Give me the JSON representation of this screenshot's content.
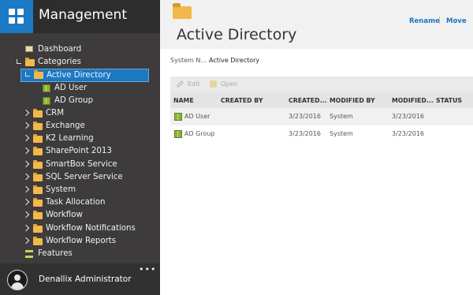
{
  "app": {
    "title": "Management",
    "brand_color": "#1a7ac3"
  },
  "sidebar": {
    "items": [
      {
        "label": "Dashboard",
        "icon": "dashboard-icon"
      },
      {
        "label": "Categories",
        "icon": "folder-icon"
      },
      {
        "label": "Active Directory",
        "icon": "folder-icon",
        "selected": true
      },
      {
        "label": "AD User",
        "icon": "smartobject-icon"
      },
      {
        "label": "AD Group",
        "icon": "smartobject-icon"
      },
      {
        "label": "CRM",
        "icon": "folder-icon"
      },
      {
        "label": "Exchange",
        "icon": "folder-icon"
      },
      {
        "label": "K2 Learning",
        "icon": "folder-icon"
      },
      {
        "label": "SharePoint 2013",
        "icon": "folder-icon"
      },
      {
        "label": "SmartBox Service",
        "icon": "folder-icon"
      },
      {
        "label": "SQL Server Service",
        "icon": "folder-icon"
      },
      {
        "label": "System",
        "icon": "folder-icon"
      },
      {
        "label": "Task Allocation",
        "icon": "folder-icon"
      },
      {
        "label": "Workflow",
        "icon": "folder-icon"
      },
      {
        "label": "Workflow Notifications",
        "icon": "folder-icon"
      },
      {
        "label": "Workflow Reports",
        "icon": "folder-icon"
      },
      {
        "label": "Features",
        "icon": "features-icon"
      }
    ]
  },
  "user": {
    "name": "Denallix Administrator",
    "more": "•••"
  },
  "header": {
    "title": "Active Directory",
    "actions": {
      "rename": "Rename",
      "separator": "|",
      "move": "Move"
    }
  },
  "info": {
    "label": "System N...",
    "value": "Active Directory"
  },
  "toolbar": {
    "edit": "Edit",
    "open": "Open"
  },
  "table": {
    "columns": [
      "NAME",
      "CREATED BY",
      "CREATED...",
      "MODIFIED BY",
      "MODIFIED...",
      "STATUS"
    ],
    "rows": [
      {
        "name": "AD User",
        "created_by": "",
        "created": "3/23/2016",
        "modified_by": "System",
        "modified": "3/23/2016",
        "status": ""
      },
      {
        "name": "AD Group",
        "created_by": "",
        "created": "3/23/2016",
        "modified_by": "System",
        "modified": "3/23/2016",
        "status": ""
      }
    ]
  }
}
